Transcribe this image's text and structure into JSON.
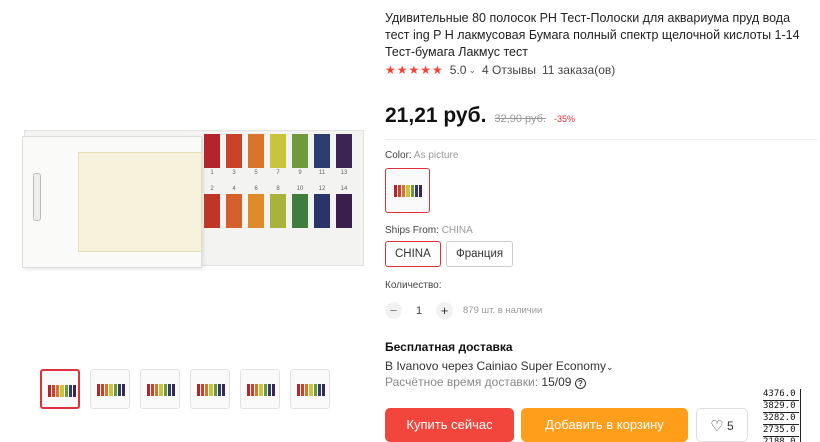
{
  "product": {
    "title": "Удивительные 80 полосок PH Тест-Полоски для аквариума пруд вода тест ing P H лакмусовая Бумага полный спектр щелочной кислоты 1-14 Тест-бумага Лакмус тест",
    "rating_value": "5.0",
    "reviews": "4 Отзывы",
    "orders": "11 заказа(ов)",
    "price": "21,21 руб.",
    "old_price": "32,90 руб.",
    "discount": "-35%"
  },
  "gallery": {
    "strip_numbers_top": [
      "1",
      "3",
      "5",
      "7",
      "9",
      "11",
      "13"
    ],
    "strip_numbers_bottom": [
      "2",
      "4",
      "6",
      "8",
      "10",
      "12",
      "14"
    ],
    "strip_colors_top": [
      "#b3242b",
      "#c9432b",
      "#d9742b",
      "#c9c43a",
      "#6f9a3c",
      "#2c3e6e",
      "#3c2453"
    ],
    "strip_colors_bottom": [
      "#bf3528",
      "#d5602a",
      "#e08a2a",
      "#a9b23a",
      "#3f7d3e",
      "#2b3468",
      "#3a1f4c"
    ],
    "thumb_count": 6
  },
  "options": {
    "color_label": "Color:",
    "color_value": "As picture",
    "ships_label": "Ships From:",
    "ships_value": "CHINA",
    "ships_options": [
      "CHINA",
      "Франция"
    ],
    "qty_label": "Количество:",
    "qty_minus": "−",
    "qty_value": "1",
    "qty_plus": "+",
    "qty_available": "879 шт. в наличии"
  },
  "shipping": {
    "title": "Бесплатная доставка",
    "line": "В Ivanovo через Cainiao Super Economy",
    "time_label": "Расчётное время доставки:",
    "time_value": "15/09"
  },
  "actions": {
    "buy": "Купить сейчас",
    "cart": "Добавить в корзину",
    "wishlist_count": "5"
  },
  "overlay_numbers": [
    "4376.0",
    "3829.0",
    "3282.0",
    "2735.0",
    "2188.0"
  ],
  "colors": {
    "accent": "#f2453c",
    "cart": "#ff9e1b",
    "star": "#f44336"
  }
}
